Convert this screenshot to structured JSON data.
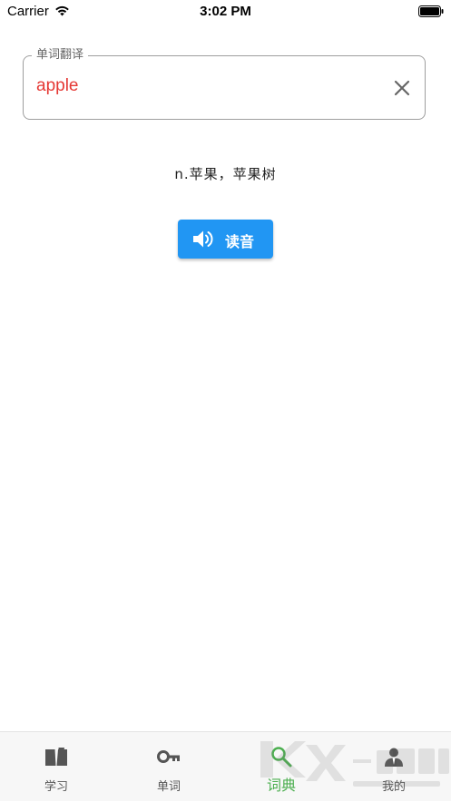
{
  "status_bar": {
    "carrier": "Carrier",
    "time": "3:02 PM"
  },
  "search_field": {
    "label": "单词翻译",
    "value": "apple"
  },
  "result": {
    "translation": "n.苹果，苹果树"
  },
  "speak_button": {
    "label": "读音"
  },
  "nav": {
    "items": [
      {
        "label": "学习",
        "icon": "book-icon"
      },
      {
        "label": "单词",
        "icon": "key-icon"
      },
      {
        "label": "词典",
        "icon": "search-icon",
        "active": true
      },
      {
        "label": "我的",
        "icon": "user-icon"
      }
    ]
  },
  "colors": {
    "accent": "#2196f3",
    "active_tab": "#4caf50",
    "input_text": "#e53935"
  }
}
